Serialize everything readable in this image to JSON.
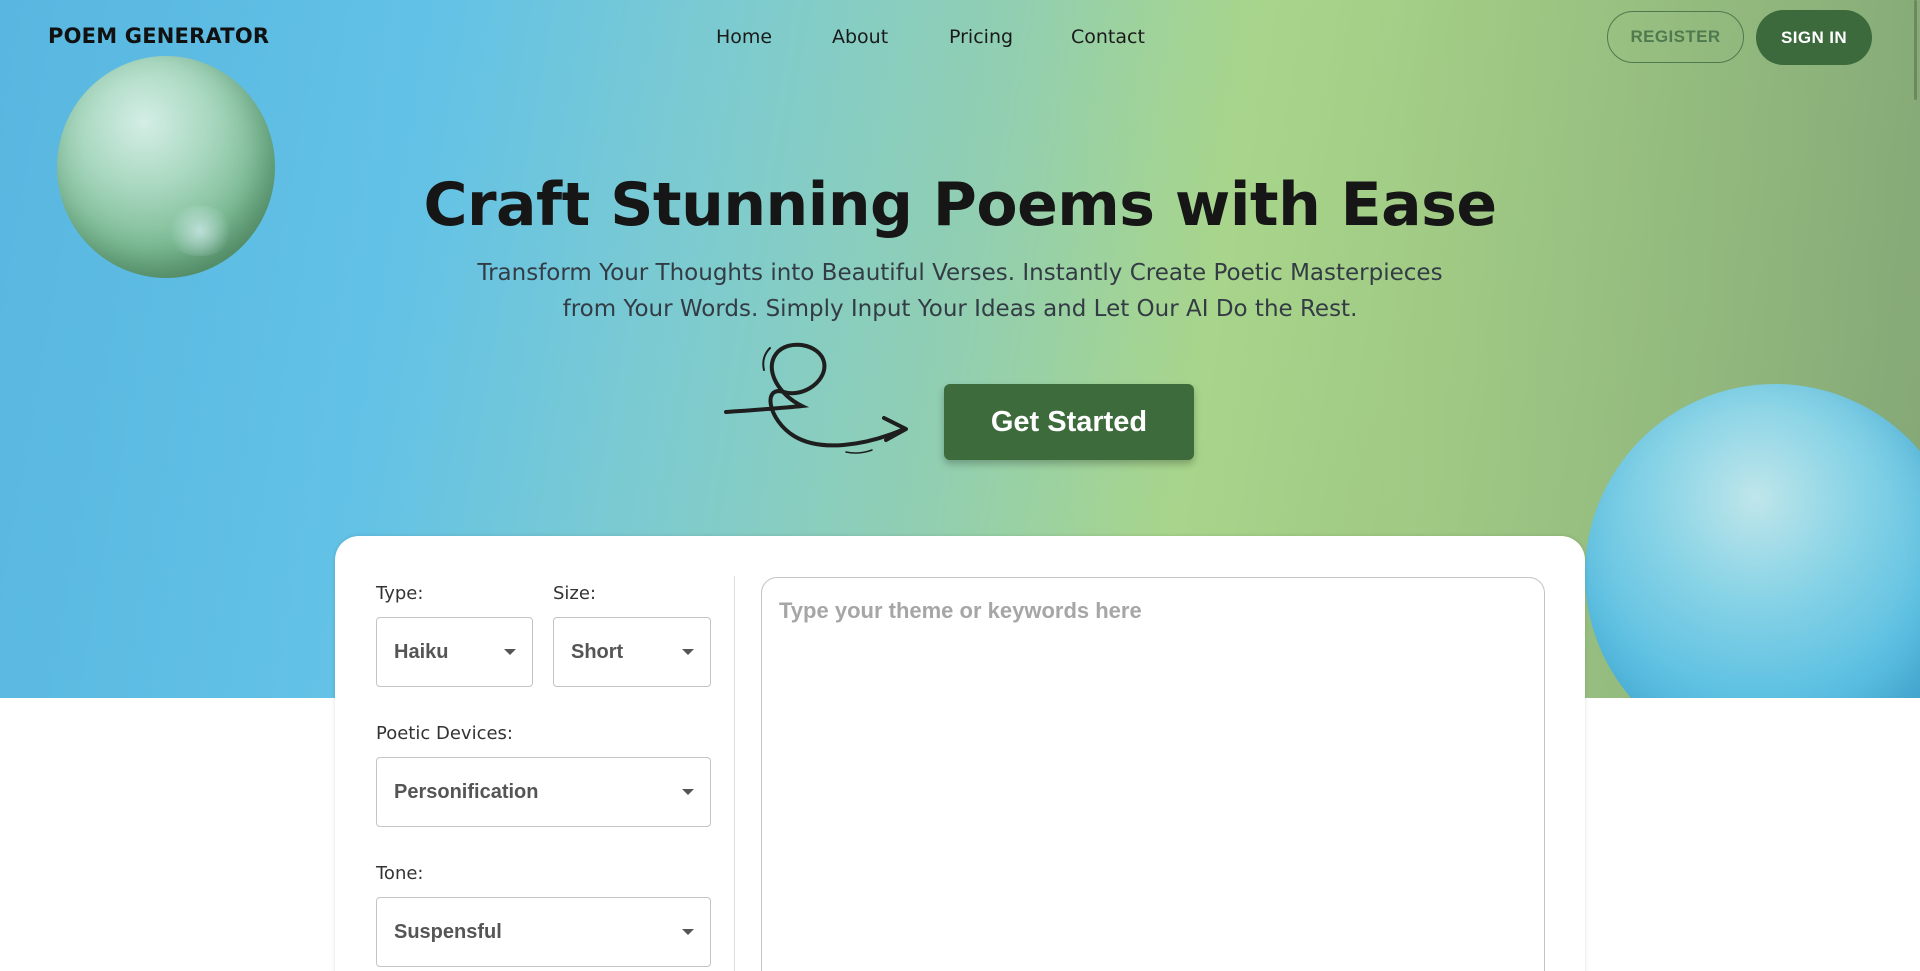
{
  "header": {
    "logo": "POEM GENERATOR",
    "nav": [
      "Home",
      "About",
      "Pricing",
      "Contact"
    ],
    "register_label": "REGISTER",
    "signin_label": "SIGN IN"
  },
  "hero": {
    "title": "Craft Stunning Poems with Ease",
    "subtitle": "Transform Your Thoughts into Beautiful Verses. Instantly Create Poetic Masterpieces from Your Words. Simply Input Your Ideas and Let Our AI Do the Rest.",
    "cta_label": "Get Started"
  },
  "form": {
    "type": {
      "label": "Type:",
      "value": "Haiku"
    },
    "size": {
      "label": "Size:",
      "value": "Short"
    },
    "devices": {
      "label": "Poetic Devices:",
      "value": "Personification"
    },
    "tone": {
      "label": "Tone:",
      "value": "Suspensful"
    },
    "theme": {
      "placeholder": "Type your theme or keywords here",
      "value": ""
    }
  },
  "colors": {
    "brand_green": "#3c6a3c",
    "hero_blue": "#5cbde4",
    "hero_green": "#a8d58c"
  }
}
